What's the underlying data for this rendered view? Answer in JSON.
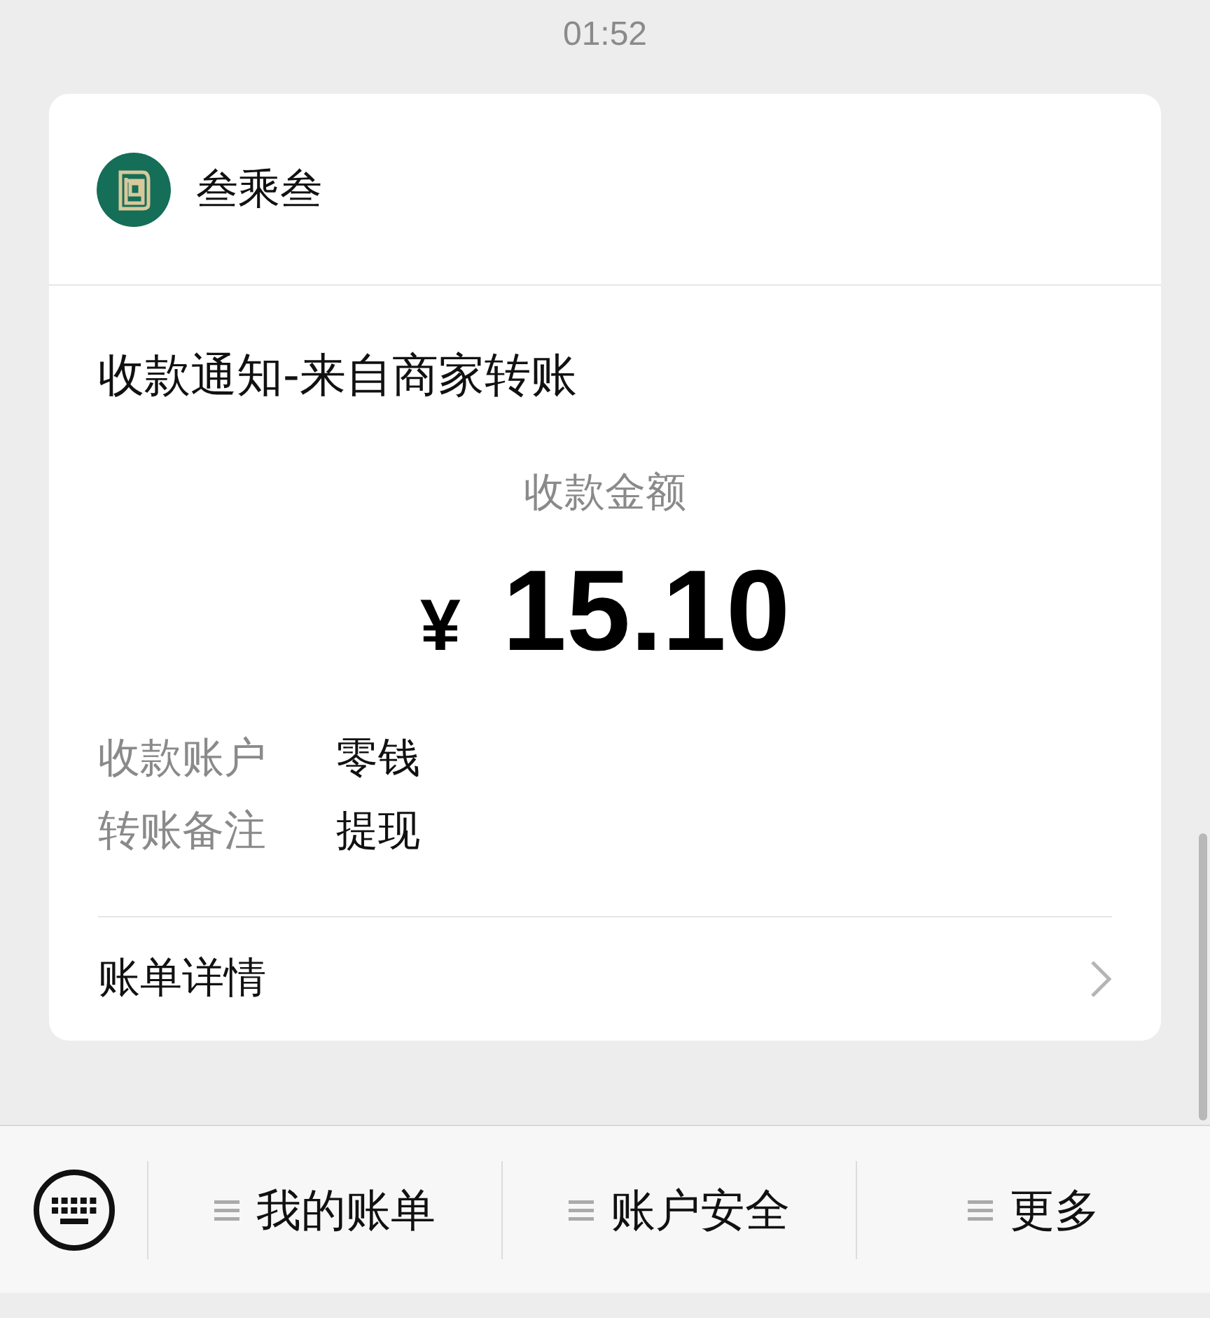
{
  "status_time": "01:52",
  "message": {
    "sender": "叁乘叁",
    "title": "收款通知-来自商家转账",
    "amount_label": "收款金额",
    "currency": "¥",
    "amount": "15.10",
    "details": [
      {
        "label": "收款账户",
        "value": "零钱"
      },
      {
        "label": "转账备注",
        "value": "提现"
      }
    ],
    "footer_link": "账单详情"
  },
  "menu": [
    {
      "label": "我的账单"
    },
    {
      "label": "账户安全"
    },
    {
      "label": "更多"
    }
  ]
}
